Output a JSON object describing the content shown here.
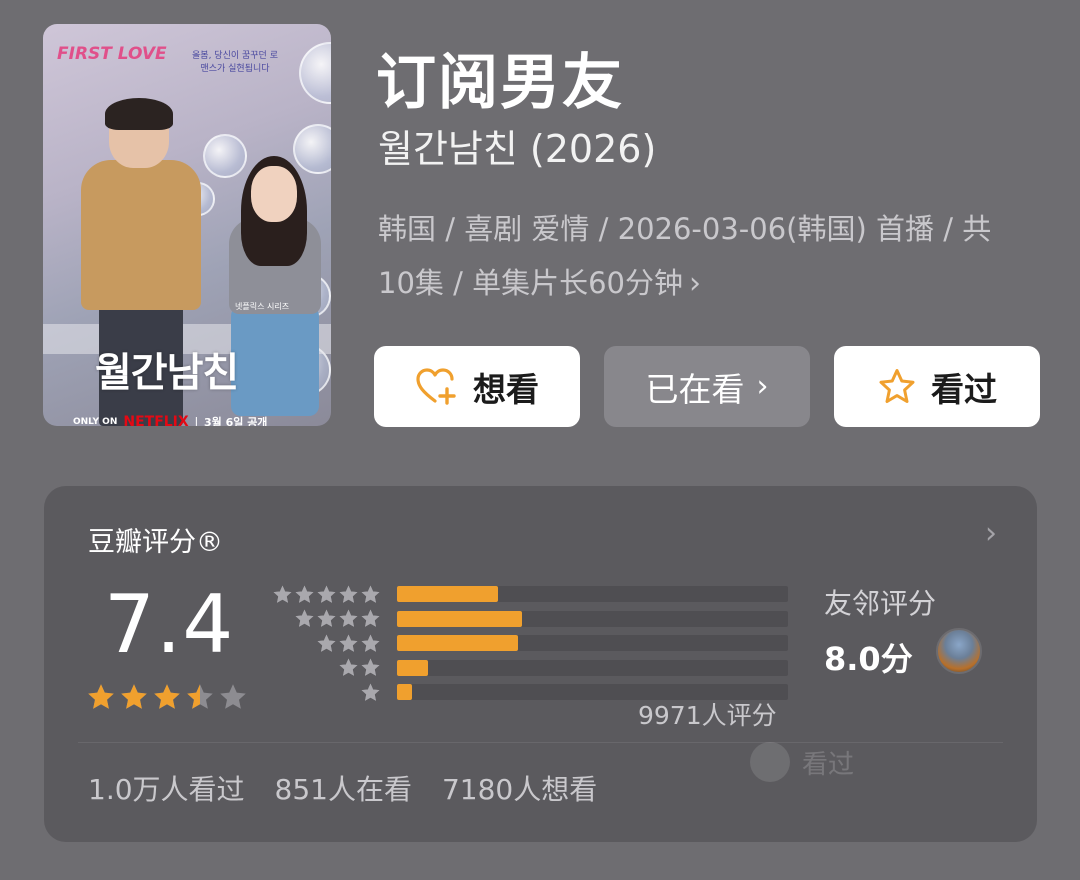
{
  "poster": {
    "brand_text": "FIRST LOVE",
    "korean_top_text": "올봄, 당신이 꿈꾸던 로맨스가 실현됩니다",
    "series_tag": "넷플릭스 시리즈",
    "logo_text": "월간남친",
    "only_on": "ONLY ON",
    "netflix": "NETFLIX",
    "release_note": "3월 6일 공개"
  },
  "header": {
    "title": "订阅男友",
    "original_title": "월간남친 (2026)",
    "meta_line1": "韩国 / 喜剧 爱情 / 2026-03-06(韩国) 首播 / 共",
    "meta_line2": "10集 / 单集片长60分钟"
  },
  "actions": {
    "want_label": "想看",
    "watching_label": "已在看",
    "watched_label": "看过"
  },
  "rating": {
    "label": "豆瓣评分®",
    "score": "7.4",
    "score_value": 7.4,
    "star_fill": 3.5,
    "distribution": [
      {
        "stars": 5,
        "fraction": 0.26
      },
      {
        "stars": 4,
        "fraction": 0.32
      },
      {
        "stars": 3,
        "fraction": 0.31
      },
      {
        "stars": 2,
        "fraction": 0.08
      },
      {
        "stars": 1,
        "fraction": 0.04
      }
    ],
    "count_text": "9971人评分",
    "friends_label": "友邻评分",
    "friends_score": "8.0分",
    "ghost_label": "看过"
  },
  "stats": {
    "watched": "1.0万人看过",
    "watching": "851人在看",
    "want": "7180人想看"
  },
  "colors": {
    "background": "#6e6d71",
    "card": "#5b5a5e",
    "accent_orange": "#f0a02e",
    "button_white": "#ffffff",
    "button_grey": "#88878c"
  }
}
